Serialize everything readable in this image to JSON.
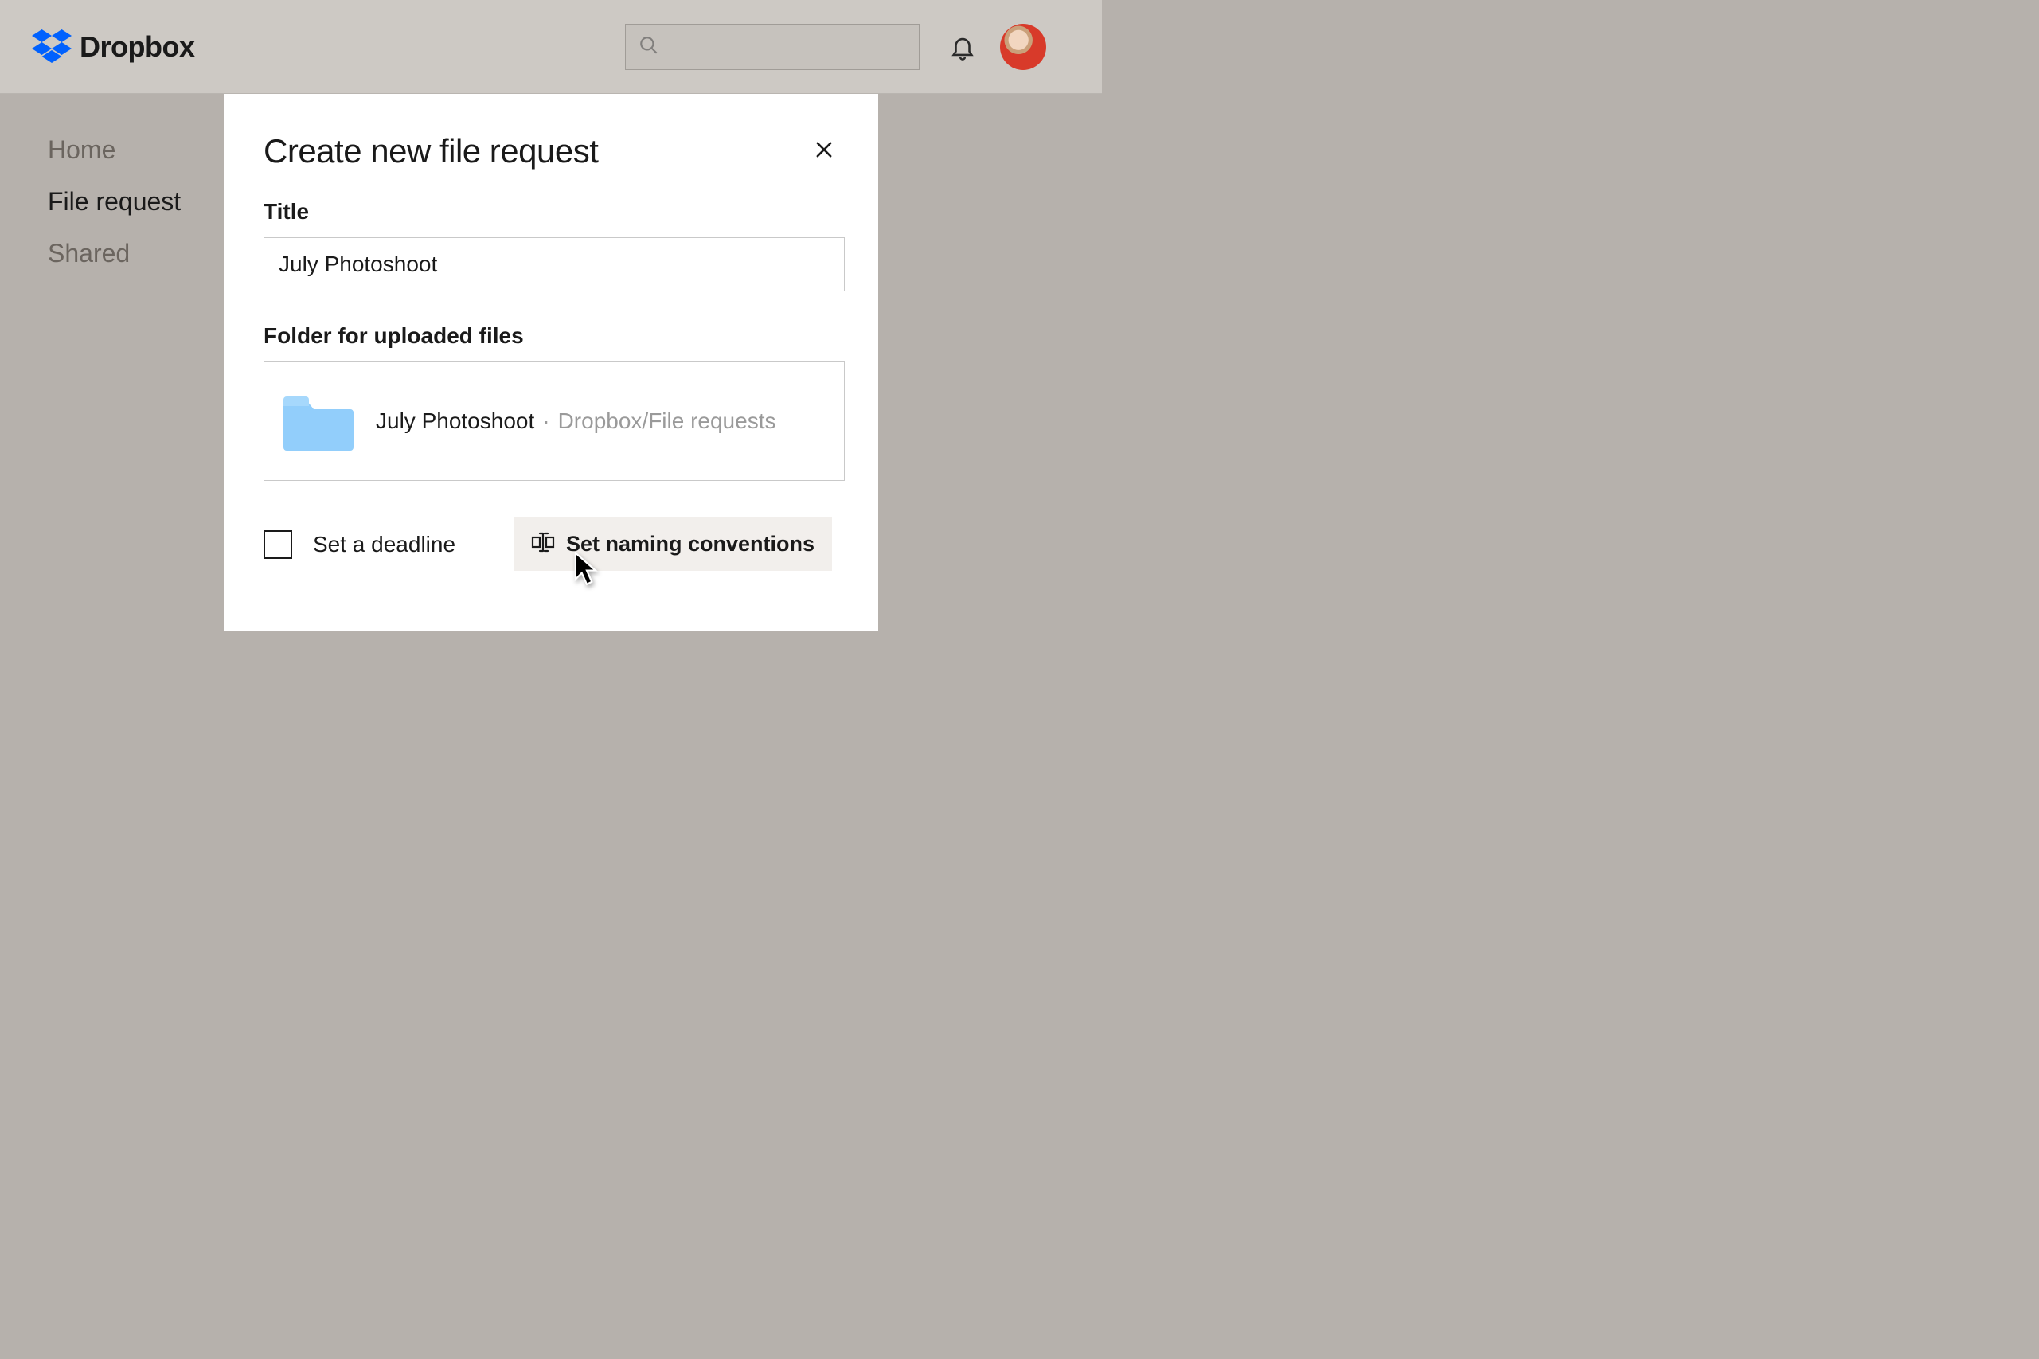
{
  "header": {
    "brand": "Dropbox"
  },
  "sidebar": {
    "items": [
      {
        "label": "Home",
        "active": false
      },
      {
        "label": "File request",
        "active": true
      },
      {
        "label": "Shared",
        "active": false
      }
    ]
  },
  "modal": {
    "title": "Create new file request",
    "title_field_label": "Title",
    "title_value": "July Photoshoot",
    "folder_field_label": "Folder for uploaded files",
    "folder_name": "July Photoshoot",
    "folder_separator": "·",
    "folder_path": "Dropbox/File requests",
    "deadline_label": "Set a deadline",
    "naming_label": "Set naming conventions"
  }
}
